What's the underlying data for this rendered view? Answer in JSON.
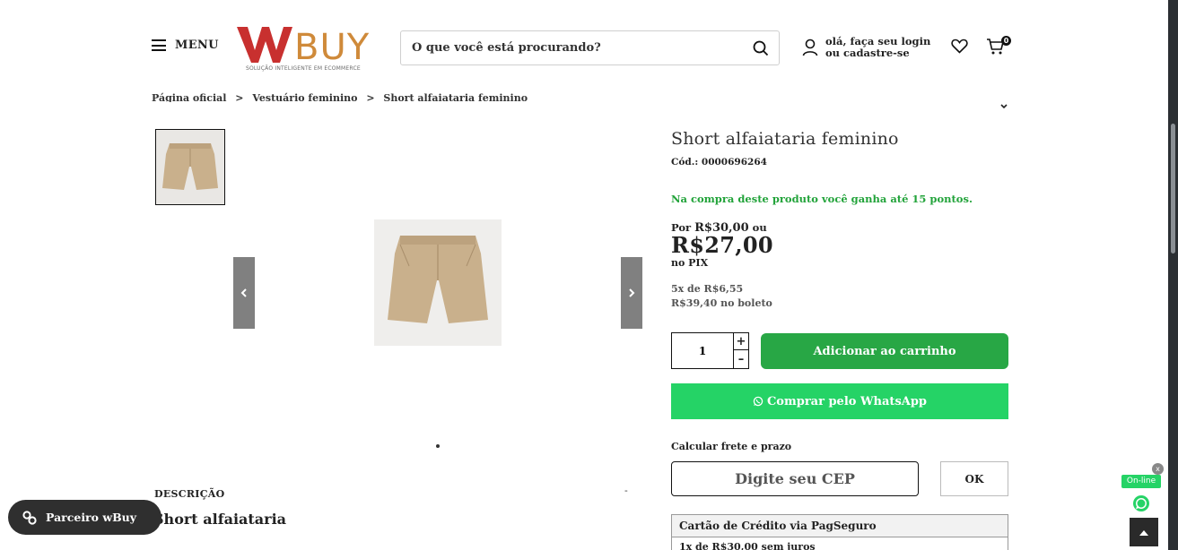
{
  "header": {
    "menu_label": "MENU",
    "logo_text": "WBUY",
    "logo_tagline": "SOLUÇÃO INTELIGENTE EM ECOMMERCE",
    "search_placeholder": "O que você está procurando?",
    "account_line1": "olá, faça seu login",
    "account_line2": "ou cadastre-se",
    "cart_count": "0",
    "colors": {
      "logo_red": "#c8302f",
      "logo_gold": "#cf8a3a"
    }
  },
  "breadcrumb": [
    "Página oficial",
    "Vestuário feminino",
    "Short alfaiataria feminino"
  ],
  "breadcrumb_separator": ">",
  "gallery": {
    "icons": [
      "chevron-left-icon",
      "chevron-right-icon"
    ]
  },
  "description": {
    "heading": "DESCRIÇÃO",
    "toggle": "-",
    "title": "Short alfaiataria"
  },
  "product": {
    "title": "Short alfaiataria feminino",
    "code": "Cód.: 0000696264",
    "points_text": "Na compra deste produto você ganha até 15 pontos.",
    "price_from_prefix": "Por",
    "price_from": "R$30,00",
    "price_from_suffix": "ou",
    "price_pix": "R$27,00",
    "pix_label": "no PIX",
    "installments": "5x de R$6,55",
    "boleto": "R$39,40 no boleto",
    "quantity": "1",
    "qty_plus": "+",
    "qty_minus": "–",
    "add_to_cart": "Adicionar ao carrinho",
    "whatsapp_buy": "Comprar pelo WhatsApp",
    "shipping_label": "Calcular frete e prazo",
    "cep_placeholder": "Digite seu CEP",
    "ok_label": "OK",
    "payment_method": "Cartão de Crédito via PagSeguro",
    "payment_row": "1x de R$30,00 sem juros",
    "colors": {
      "points_green": "#22a33a",
      "cart_green": "#28a745",
      "whatsapp_green": "#25d366"
    }
  },
  "floating": {
    "partner_label": "Parceiro wBuy",
    "online_label": "On-line",
    "close_label": "x"
  }
}
